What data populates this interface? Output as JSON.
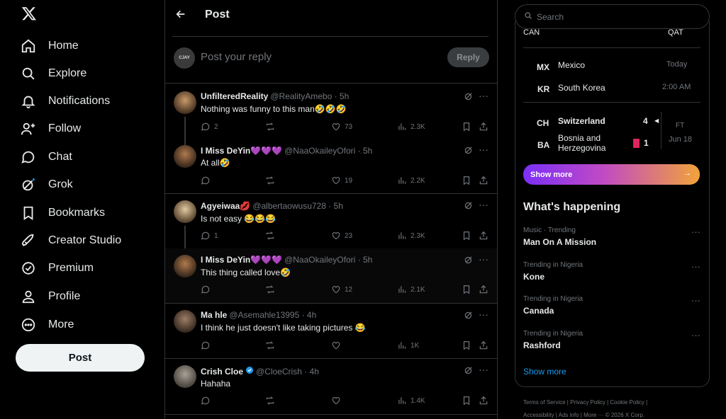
{
  "nav": {
    "logo": "X",
    "items": [
      {
        "label": "Home"
      },
      {
        "label": "Explore"
      },
      {
        "label": "Notifications"
      },
      {
        "label": "Follow"
      },
      {
        "label": "Chat"
      },
      {
        "label": "Grok"
      },
      {
        "label": "Bookmarks"
      },
      {
        "label": "Creator Studio"
      },
      {
        "label": "Premium"
      },
      {
        "label": "Profile"
      },
      {
        "label": "More"
      }
    ],
    "post_label": "Post"
  },
  "header": {
    "title": "Post"
  },
  "reply": {
    "avatar_text": "CJAY",
    "placeholder": "Post your reply",
    "button": "Reply"
  },
  "tweets": [
    {
      "name": "UnfilteredReality",
      "handle": "@RealityAmebo · 5h",
      "text": "Nothing was funny to this man🤣🤣🤣",
      "replies": "2",
      "retweets": "",
      "likes": "73",
      "views": "2.3K"
    },
    {
      "name": "I Miss DeYin💜💜💜",
      "handle": "@NaaOkaileyOfori · 5h",
      "text": "At all🤣",
      "replies": "",
      "retweets": "",
      "likes": "19",
      "views": "2.2K"
    },
    {
      "name": "Agyeiwaa💋",
      "handle": "@albertaowusu728 · 5h",
      "text": "Is not easy 😂😂😂",
      "replies": "1",
      "retweets": "",
      "likes": "23",
      "views": "2.3K"
    },
    {
      "name": "I Miss DeYin💜💜💜",
      "handle": "@NaaOkaileyOfori · 5h",
      "text": "This thing called love🤣",
      "replies": "",
      "retweets": "",
      "likes": "12",
      "views": "2.1K"
    },
    {
      "name": "Ma hle",
      "handle": "@Asemahle13995 · 4h",
      "text": "I think he just doesn't like taking pictures 😂",
      "replies": "",
      "retweets": "",
      "likes": "",
      "views": "1K"
    },
    {
      "name": "Crish Cloe",
      "handle": "@CloeCrish · 4h",
      "text": "Hahaha",
      "replies": "",
      "retweets": "",
      "likes": "",
      "views": "1.4K"
    }
  ],
  "search": {
    "placeholder": "Search"
  },
  "matches": {
    "top_left": "CAN",
    "top_right": "QAT",
    "m1": {
      "code1": "MX",
      "team1": "Mexico",
      "time1": "Today",
      "code2": "KR",
      "team2": "South Korea",
      "time2": "2:00 AM"
    },
    "m2": {
      "code1": "CH",
      "team1": "Switzerland",
      "score1": "4",
      "status": "FT",
      "code2": "BA",
      "team2a": "Bosnia and",
      "team2b": "Herzegovina",
      "score2": "1",
      "date": "Jun 18"
    },
    "show_more": "Show more"
  },
  "happening": {
    "title": "What's happening",
    "trends": [
      {
        "context": "Music · Trending",
        "title": "Man On A Mission"
      },
      {
        "context": "Trending in Nigeria",
        "title": "Kone"
      },
      {
        "context": "Trending in Nigeria",
        "title": "Canada"
      },
      {
        "context": "Trending in Nigeria",
        "title": "Rashford"
      }
    ],
    "show_more": "Show more"
  },
  "footer": {
    "line1": "Terms of Service  |   Privacy Policy  |   Cookie Policy  |",
    "line2": "Accessibility  |   Ads info  |   More ···    © 2026 X Corp."
  },
  "colors": {
    "accent": "#1d9bf0",
    "bg": "#000000",
    "border": "#2f3336",
    "muted": "#71767b",
    "red_card": "#e0245e"
  }
}
